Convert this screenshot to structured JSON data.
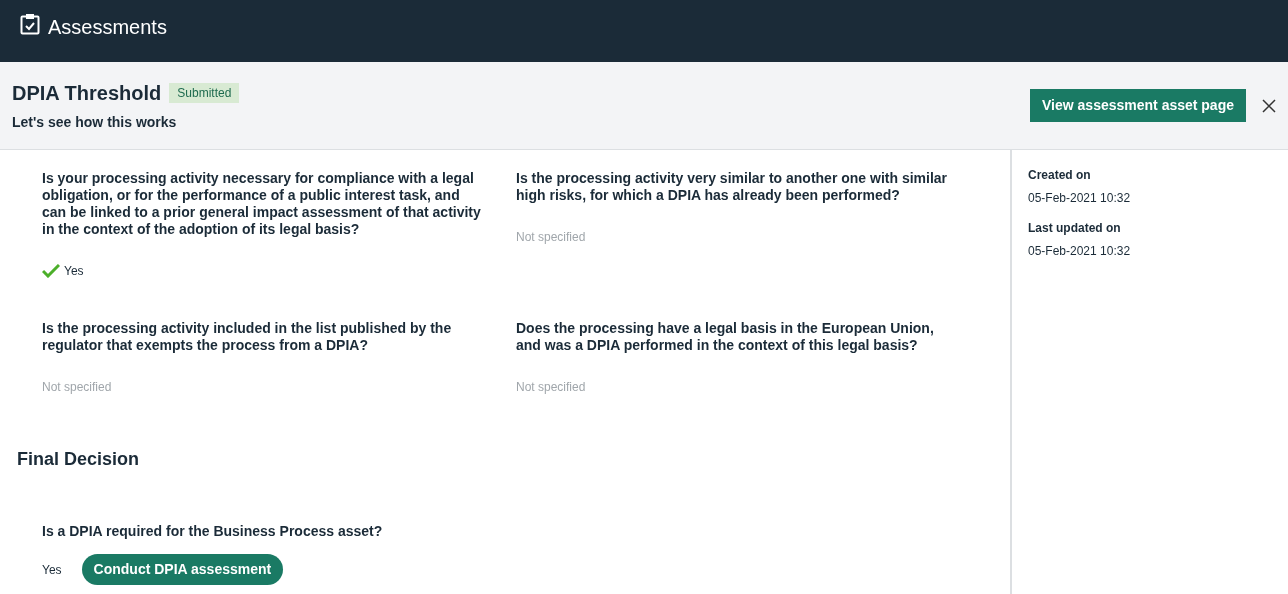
{
  "app_bar": {
    "title": "Assessments"
  },
  "header": {
    "title": "DPIA Threshold",
    "status": "Submitted",
    "subtitle": "Let's see how this works",
    "action": "View assessment asset page"
  },
  "questions": [
    {
      "question": "Is your processing activity necessary for compliance with a legal obligation, or for the performance of a public interest task, and can be linked to a prior general impact assessment of that activity in the context of the adoption of its legal basis?",
      "answer": "Yes",
      "kind": "yes"
    },
    {
      "question": "Is the processing activity very similar to another one with similar high risks, for which a DPIA has already been performed?",
      "answer": "Not specified",
      "kind": "unspecified"
    },
    {
      "question": "Is the processing activity included in the list published by the regulator that exempts the process from a DPIA?",
      "answer": "Not specified",
      "kind": "unspecified"
    },
    {
      "question": "Does the processing have a legal basis in the European Union, and was a DPIA performed in the context of this legal basis?",
      "answer": "Not specified",
      "kind": "unspecified"
    }
  ],
  "final_decision": {
    "heading": "Final Decision",
    "question": "Is a DPIA required for the Business Process asset?",
    "answer": "Yes",
    "action": "Conduct DPIA assessment"
  },
  "details": [
    {
      "label": "Created on",
      "value": "05-Feb-2021 10:32"
    },
    {
      "label": "Last updated on",
      "value": "05-Feb-2021 10:32"
    }
  ]
}
